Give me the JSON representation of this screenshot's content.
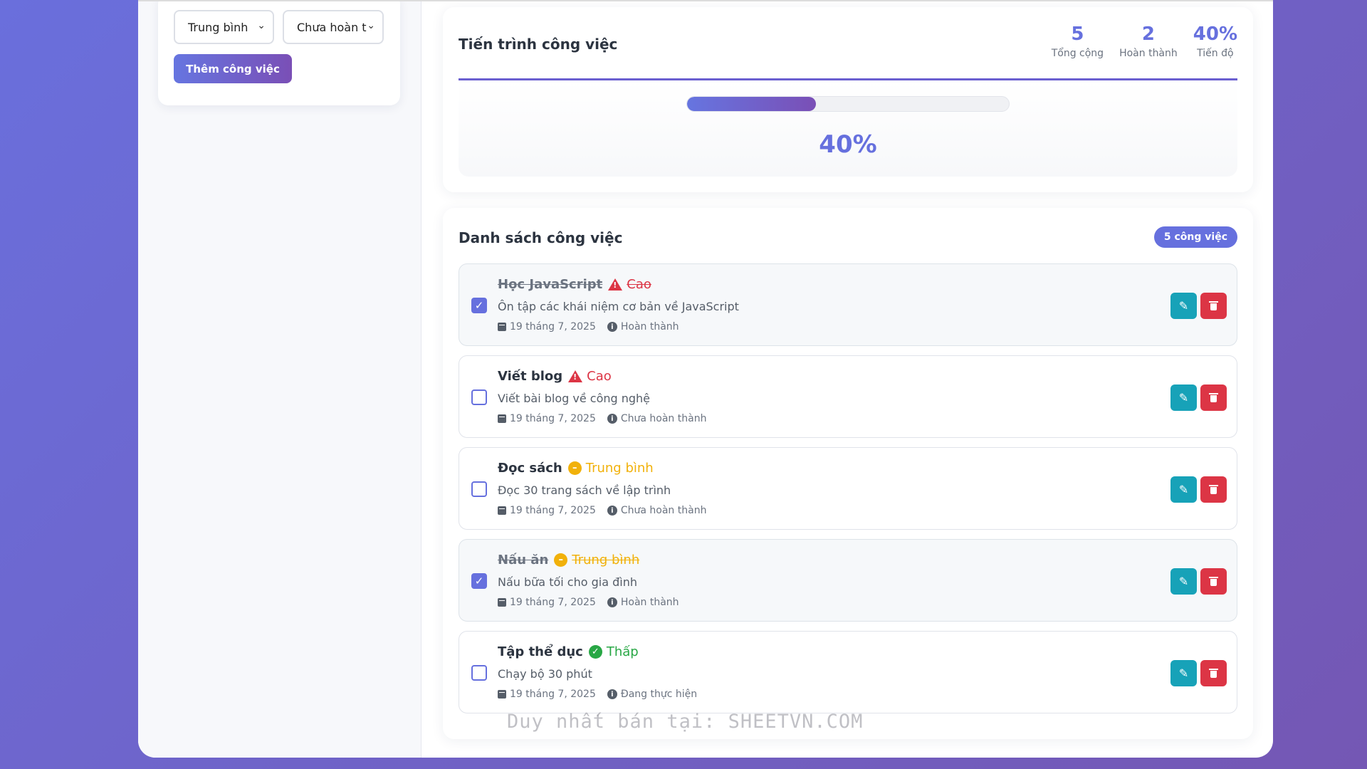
{
  "form": {
    "priority_select": "Trung bình",
    "status_select": "Chưa hoàn t",
    "add_button": "Thêm công việc"
  },
  "progress": {
    "title": "Tiến trình công việc",
    "total_value": "5",
    "total_label": "Tổng cộng",
    "done_value": "2",
    "done_label": "Hoàn thành",
    "percent_value": "40%",
    "percent_label": "Tiến độ",
    "bar_fraction": 0.4,
    "bar_text": "40%"
  },
  "list": {
    "title": "Danh sách công việc",
    "count_badge": "5 công việc",
    "tasks": [
      {
        "title": "Học JavaScript",
        "priority": "Cao",
        "desc": "Ôn tập các khái niệm cơ bản về JavaScript",
        "date": "19 tháng 7, 2025",
        "status": "Hoàn thành",
        "checked": true
      },
      {
        "title": "Viết blog",
        "priority": "Cao",
        "desc": "Viết bài blog về công nghệ",
        "date": "19 tháng 7, 2025",
        "status": "Chưa hoàn thành",
        "checked": false
      },
      {
        "title": "Đọc sách",
        "priority": "Trung bình",
        "desc": "Đọc 30 trang sách về lập trình",
        "date": "19 tháng 7, 2025",
        "status": "Chưa hoàn thành",
        "checked": false
      },
      {
        "title": "Nấu ăn",
        "priority": "Trung bình",
        "desc": "Nấu bữa tối cho gia đình",
        "date": "19 tháng 7, 2025",
        "status": "Hoàn thành",
        "checked": true
      },
      {
        "title": "Tập thể dục",
        "priority": "Thấp",
        "desc": "Chạy bộ 30 phút",
        "date": "19 tháng 7, 2025",
        "status": "Đang thực hiện",
        "checked": false
      }
    ]
  },
  "watermark": "Duy nhất bán tại: SHEETVN.COM",
  "colors": {
    "accent": "#6670de",
    "high": "#dc3545",
    "medium": "#f1b10a",
    "low": "#28a745",
    "edit": "#17a2b8"
  }
}
